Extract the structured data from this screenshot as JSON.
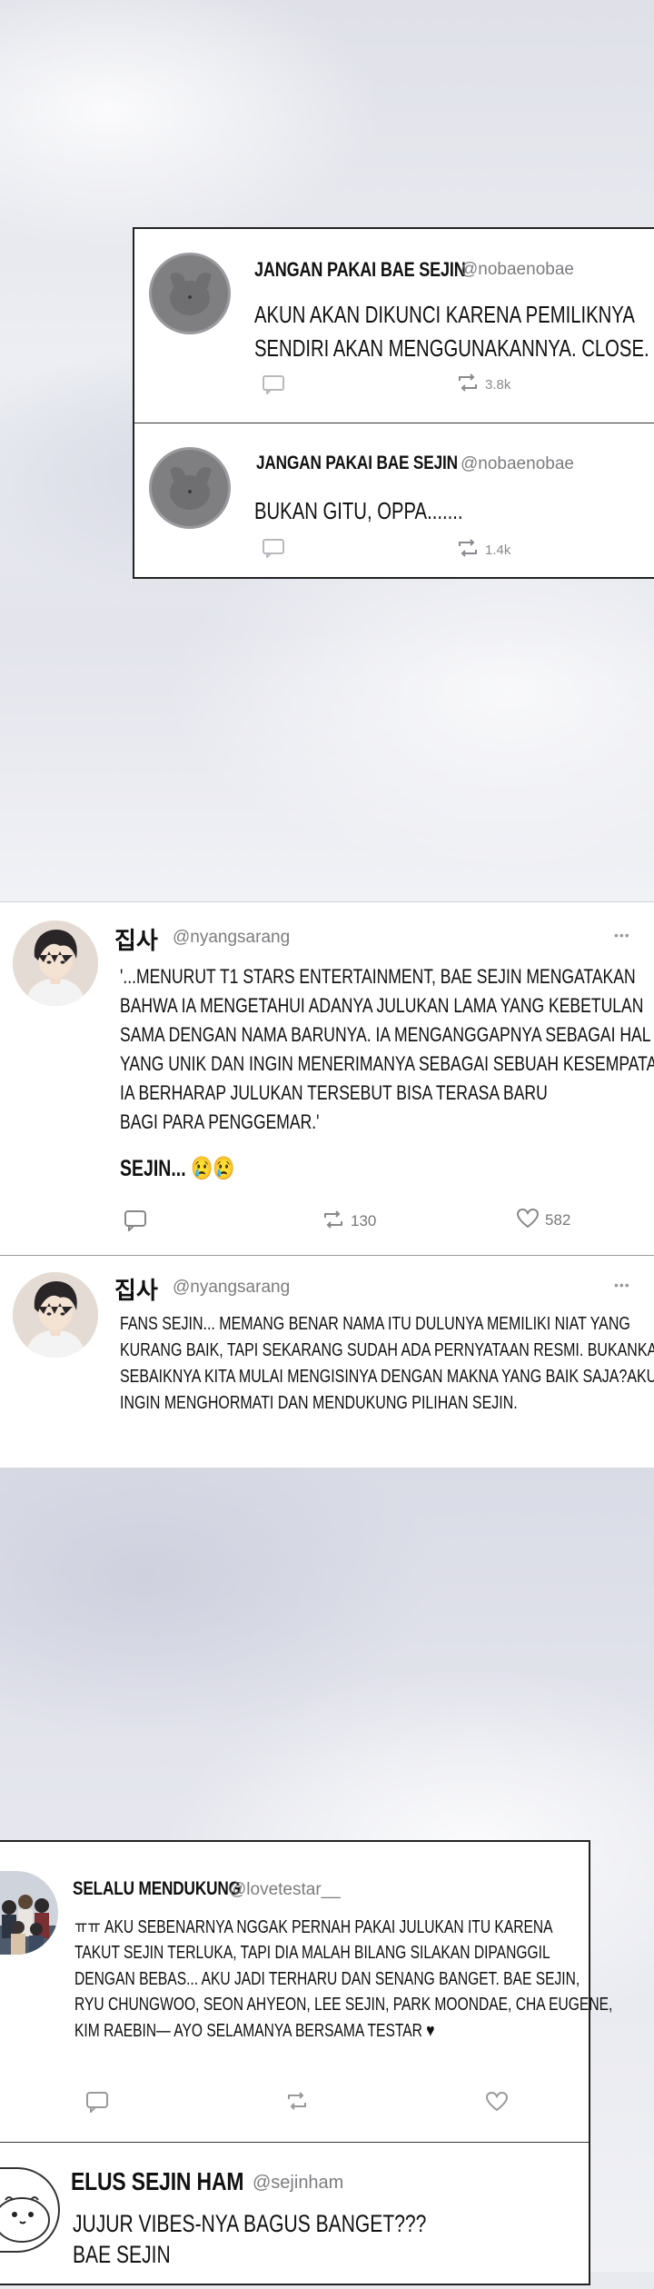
{
  "top_panel": {
    "tweets": [
      {
        "name": "JANGAN PAKAI BAE SEJIN",
        "handle": "@nobaenobae",
        "lines": [
          "AKUN AKAN DIKUNCI KARENA PEMILIKNYA",
          "SENDIRI AKAN MENGGUNAKANNYA. CLOSE."
        ],
        "retweets": "3.8k"
      },
      {
        "name": "JANGAN PAKAI BAE SEJIN",
        "handle": "@nobaenobae",
        "lines": [
          "BUKAN GITU, OPPA......."
        ],
        "retweets": "1.4k"
      }
    ]
  },
  "mid_panel": {
    "tweets": [
      {
        "name": "집사",
        "handle": "@nyangsarang",
        "more": "•••",
        "lines": [
          "'...MENURUT T1 STARS ENTERTAINMENT, BAE SEJIN MENGATAKAN",
          "BAHWA IA MENGETAHUI ADANYA JULUKAN  LAMA YANG KEBETULAN",
          "SAMA DENGAN NAMA BARUNYA. IA MENGANGGAPNYA SEBAGAI HAL",
          "YANG UNIK DAN INGIN MENERIMANYA SEBAGAI SEBUAH KESEMPATAN.",
          "IA BERHARAP JULUKAN TERSEBUT BISA TERASA BARU",
          "BAGI PARA PENGGEMAR.'"
        ],
        "tail": "SEJIN... 😢😢",
        "retweets": "130",
        "likes": "582"
      },
      {
        "name": "집사",
        "handle": "@nyangsarang",
        "more": "•••",
        "lines": [
          "FANS SEJIN... MEMANG BENAR NAMA ITU DULUNYA MEMILIKI NIAT YANG",
          "KURANG BAIK, TAPI SEKARANG SUDAH ADA PERNYATAAN RESMI. BUKANKAH",
          "SEBAIKNYA KITA MULAI MENGISINYA DENGAN MAKNA YANG BAIK SAJA?AKU",
          "INGIN MENGHORMATI DAN MENDUKUNG PILIHAN SEJIN."
        ]
      }
    ]
  },
  "bottom_panel": {
    "tweets": [
      {
        "name": "SELALU MENDUKUNG",
        "handle": "@lovetestar__",
        "lines": [
          "ㅠㅠ AKU SEBENARNYA NGGAK PERNAH PAKAI JULUKAN ITU KARENA",
          "TAKUT SEJIN TERLUKA, TAPI DIA MALAH BILANG SILAKAN DIPANGGIL",
          "DENGAN BEBAS... AKU JADI TERHARU DAN SENANG BANGET. BAE SEJIN,",
          "RYU CHUNGWOO, SEON AHYEON, LEE SEJIN, PARK MOONDAE, CHA EUGENE,",
          "KIM RAEBIN— AYO SELAMANYA BERSAMA TESTAR ♥"
        ]
      },
      {
        "name": "ELUS SEJIN HAM",
        "handle": "@sejinham",
        "lines": [
          "JUJUR VIBES-NYA BAGUS BANGET???",
          "BAE SEJIN"
        ]
      }
    ]
  },
  "colors": {
    "text": "#111111",
    "muted": "#7c7c80",
    "border": "#222222"
  }
}
